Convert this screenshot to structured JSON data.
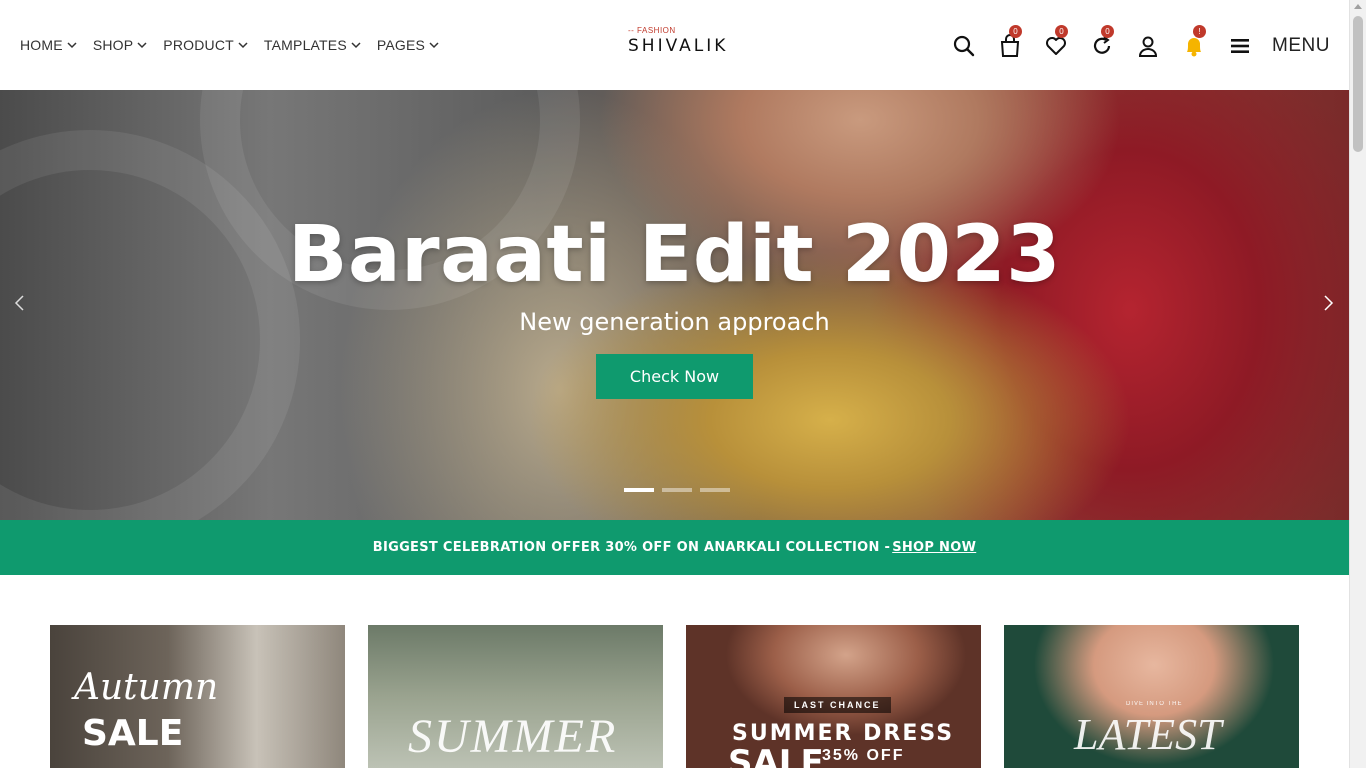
{
  "header": {
    "nav": [
      {
        "label": "HOME"
      },
      {
        "label": "SHOP"
      },
      {
        "label": "PRODUCT"
      },
      {
        "label": "TAMPLATES"
      },
      {
        "label": "PAGES"
      }
    ],
    "logo": {
      "tag": "-- FASHION",
      "name": "SHIVALIK"
    },
    "icons": {
      "search": "search-icon",
      "cart": {
        "icon": "shopping-bag-icon",
        "count": "0"
      },
      "wishlist": {
        "icon": "heart-icon",
        "count": "0"
      },
      "compare": {
        "icon": "refresh-icon",
        "count": "0"
      },
      "account": "user-icon",
      "notifications": {
        "icon": "bell-icon",
        "count": "!"
      },
      "menu": "hamburger-icon"
    },
    "menu_label": "MENU"
  },
  "hero": {
    "title": "Baraati Edit 2023",
    "subtitle": "New generation approach",
    "button": "Check Now",
    "slides": 3,
    "active_slide": 1
  },
  "offer": {
    "text": "BIGGEST CELEBRATION OFFER 30% OFF ON ANARKALI COLLECTION -",
    "link": "SHOP NOW"
  },
  "cards": [
    {
      "line1": "Autumn",
      "line2": "SALE"
    },
    {
      "line1": "SUMMER"
    },
    {
      "badge": "LAST CHANCE",
      "line1": "SUMMER DRESS",
      "line2": "SALE",
      "line3": "35% OFF"
    },
    {
      "small": "DIVE INTO THE",
      "line1": "LATEST"
    }
  ],
  "colors": {
    "accent": "#0f9a6e",
    "badge": "#c0392b",
    "bell": "#f5b400"
  }
}
